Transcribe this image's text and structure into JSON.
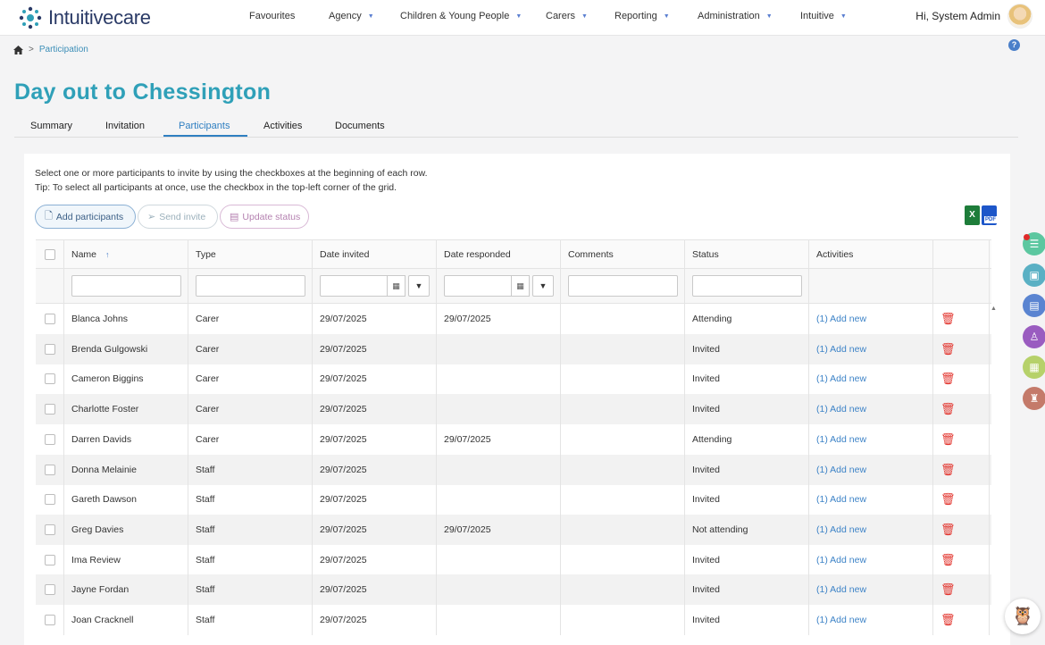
{
  "header": {
    "logo_text": "Intuitivecare",
    "nav": [
      {
        "label": "Favourites",
        "caret": false
      },
      {
        "label": "Agency",
        "caret": true
      },
      {
        "label": "Children & Young People",
        "caret": true
      },
      {
        "label": "Carers",
        "caret": true
      },
      {
        "label": "Reporting",
        "caret": true
      },
      {
        "label": "Administration",
        "caret": true
      },
      {
        "label": "Intuitive",
        "caret": true
      }
    ],
    "user_greeting": "Hi, System Admin"
  },
  "breadcrumb": {
    "separator": ">",
    "current": "Participation"
  },
  "page_title": "Day out to Chessington",
  "tabs": [
    "Summary",
    "Invitation",
    "Participants",
    "Activities",
    "Documents"
  ],
  "active_tab": "Participants",
  "instructions": {
    "line1": "Select one or more participants to invite by using the checkboxes at the beginning of each row.",
    "line2": "Tip: To select all participants at once, use the checkbox in the top-left corner of the grid."
  },
  "actions": {
    "add": "Add participants",
    "send": "Send invite",
    "update": "Update status"
  },
  "export": {
    "excel_icon": "excel-icon",
    "pdf_icon": "pdf-icon",
    "pdf_label": "PDF",
    "excel_label": "X"
  },
  "grid": {
    "columns": [
      "Name",
      "Type",
      "Date invited",
      "Date responded",
      "Comments",
      "Status",
      "Activities"
    ],
    "sort_indicator": "↑",
    "rows": [
      {
        "name": "Blanca Johns",
        "type": "Carer",
        "invited": "29/07/2025",
        "responded": "29/07/2025",
        "comments": "",
        "status": "Attending",
        "activities": "(1) Add new"
      },
      {
        "name": "Brenda Gulgowski",
        "type": "Carer",
        "invited": "29/07/2025",
        "responded": "",
        "comments": "",
        "status": "Invited",
        "activities": "(1) Add new"
      },
      {
        "name": "Cameron Biggins",
        "type": "Carer",
        "invited": "29/07/2025",
        "responded": "",
        "comments": "",
        "status": "Invited",
        "activities": "(1) Add new"
      },
      {
        "name": "Charlotte Foster",
        "type": "Carer",
        "invited": "29/07/2025",
        "responded": "",
        "comments": "",
        "status": "Invited",
        "activities": "(1) Add new"
      },
      {
        "name": "Darren Davids",
        "type": "Carer",
        "invited": "29/07/2025",
        "responded": "29/07/2025",
        "comments": "",
        "status": "Attending",
        "activities": "(1) Add new"
      },
      {
        "name": "Donna Melainie",
        "type": "Staff",
        "invited": "29/07/2025",
        "responded": "",
        "comments": "",
        "status": "Invited",
        "activities": "(1) Add new"
      },
      {
        "name": "Gareth Dawson",
        "type": "Staff",
        "invited": "29/07/2025",
        "responded": "",
        "comments": "",
        "status": "Invited",
        "activities": "(1) Add new"
      },
      {
        "name": "Greg Davies",
        "type": "Staff",
        "invited": "29/07/2025",
        "responded": "29/07/2025",
        "comments": "",
        "status": "Not attending",
        "activities": "(1) Add new"
      },
      {
        "name": "Ima Review",
        "type": "Staff",
        "invited": "29/07/2025",
        "responded": "",
        "comments": "",
        "status": "Invited",
        "activities": "(1) Add new"
      },
      {
        "name": "Jayne Fordan",
        "type": "Staff",
        "invited": "29/07/2025",
        "responded": "",
        "comments": "",
        "status": "Invited",
        "activities": "(1) Add new"
      },
      {
        "name": "Joan Cracknell",
        "type": "Staff",
        "invited": "29/07/2025",
        "responded": "",
        "comments": "",
        "status": "Invited",
        "activities": "(1) Add new"
      }
    ]
  },
  "rail": [
    {
      "icon": "list-icon",
      "color": "#5cc7a0"
    },
    {
      "icon": "briefcase-icon",
      "color": "#5ab0c4"
    },
    {
      "icon": "document-icon",
      "color": "#5a84d1"
    },
    {
      "icon": "person-icon",
      "color": "#9a5cc0"
    },
    {
      "icon": "calendar-icon",
      "color": "#b6d16a"
    },
    {
      "icon": "stamp-icon",
      "color": "#c47a6a"
    }
  ],
  "colors": {
    "title": "#2fa0b8",
    "link": "#3d83c7",
    "delete": "#e2332c"
  }
}
